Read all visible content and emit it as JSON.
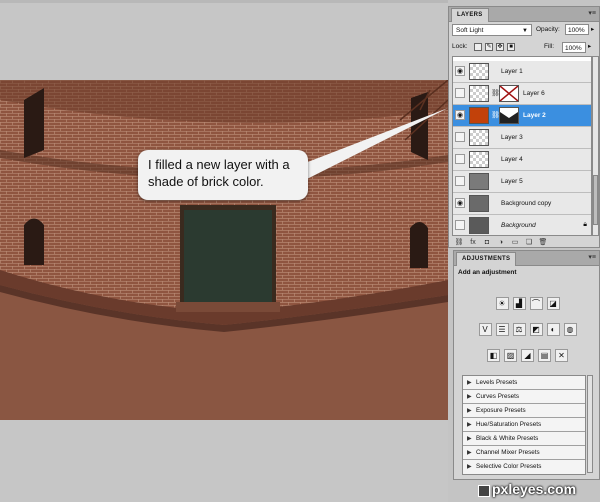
{
  "layers_panel": {
    "tab": "LAYERS",
    "blend_mode": "Soft Light",
    "opacity_label": "Opacity:",
    "opacity_value": "100%",
    "lock_label": "Lock:",
    "fill_label": "Fill:",
    "fill_value": "100%",
    "layers": [
      {
        "name": "Layer 1",
        "visible": true,
        "selected": false
      },
      {
        "name": "Layer 6",
        "visible": false,
        "selected": false
      },
      {
        "name": "Layer 2",
        "visible": true,
        "selected": true
      },
      {
        "name": "Layer 3",
        "visible": false,
        "selected": false
      },
      {
        "name": "Layer 4",
        "visible": false,
        "selected": false
      },
      {
        "name": "Layer 5",
        "visible": false,
        "selected": false
      },
      {
        "name": "Background copy",
        "visible": true,
        "selected": false
      },
      {
        "name": "Background",
        "visible": false,
        "selected": false
      }
    ]
  },
  "adjustments_panel": {
    "tab": "ADJUSTMENTS",
    "subtitle": "Add an adjustment",
    "presets": [
      "Levels Presets",
      "Curves Presets",
      "Exposure Presets",
      "Hue/Saturation Presets",
      "Black & White Presets",
      "Channel Mixer Presets",
      "Selective Color Presets"
    ]
  },
  "callout": {
    "line1": "I filled a new layer with a",
    "line2": "shade of brick color."
  },
  "watermark": "pxleyes.com",
  "colors": {
    "selected_layer": "#3b8fe0",
    "brick_tint": "#8a4a30",
    "layer2_fill": "#c2410a"
  }
}
